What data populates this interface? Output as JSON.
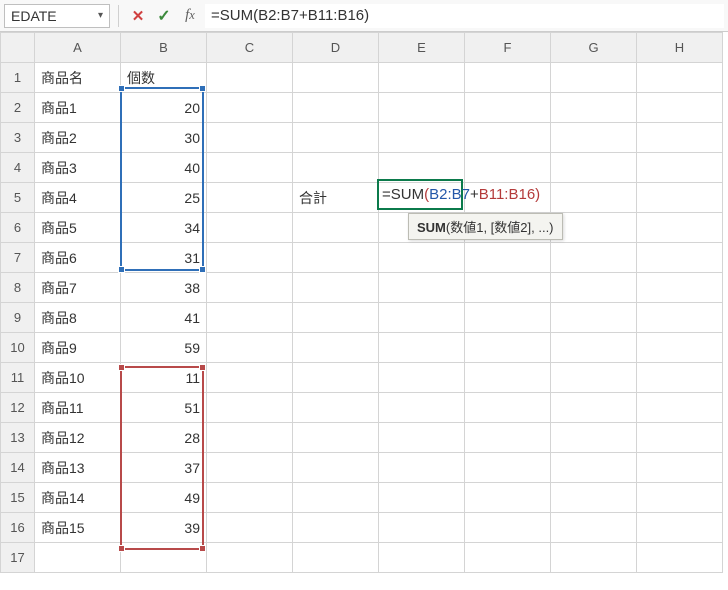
{
  "name_box": "EDATE",
  "formula_bar": "=SUM(B2:B7+B11:B16)",
  "columns": [
    "A",
    "B",
    "C",
    "D",
    "E",
    "F",
    "G",
    "H"
  ],
  "row_count": 17,
  "headers": {
    "A1": "商品名",
    "B1": "個数"
  },
  "products": [
    {
      "name": "商品1",
      "qty": 20
    },
    {
      "name": "商品2",
      "qty": 30
    },
    {
      "name": "商品3",
      "qty": 40
    },
    {
      "name": "商品4",
      "qty": 25
    },
    {
      "name": "商品5",
      "qty": 34
    },
    {
      "name": "商品6",
      "qty": 31
    },
    {
      "name": "商品7",
      "qty": 38
    },
    {
      "name": "商品8",
      "qty": 41
    },
    {
      "name": "商品9",
      "qty": 59
    },
    {
      "name": "商品10",
      "qty": 11
    },
    {
      "name": "商品11",
      "qty": 51
    },
    {
      "name": "商品12",
      "qty": 28
    },
    {
      "name": "商品13",
      "qty": 37
    },
    {
      "name": "商品14",
      "qty": 49
    },
    {
      "name": "商品15",
      "qty": 39
    }
  ],
  "label_D5": "合計",
  "inline_formula": {
    "prefix": "=SUM",
    "lparen": "(",
    "range1": "B2:B7",
    "plus": "+",
    "range2": "B11:B16",
    "rparen": ")"
  },
  "tooltip": {
    "fn": "SUM",
    "sig": "(数値1, [数値2], ...)"
  },
  "colors": {
    "blue": "#2f6fb8",
    "red": "#b84a4a",
    "active": "#0b7a4b"
  }
}
